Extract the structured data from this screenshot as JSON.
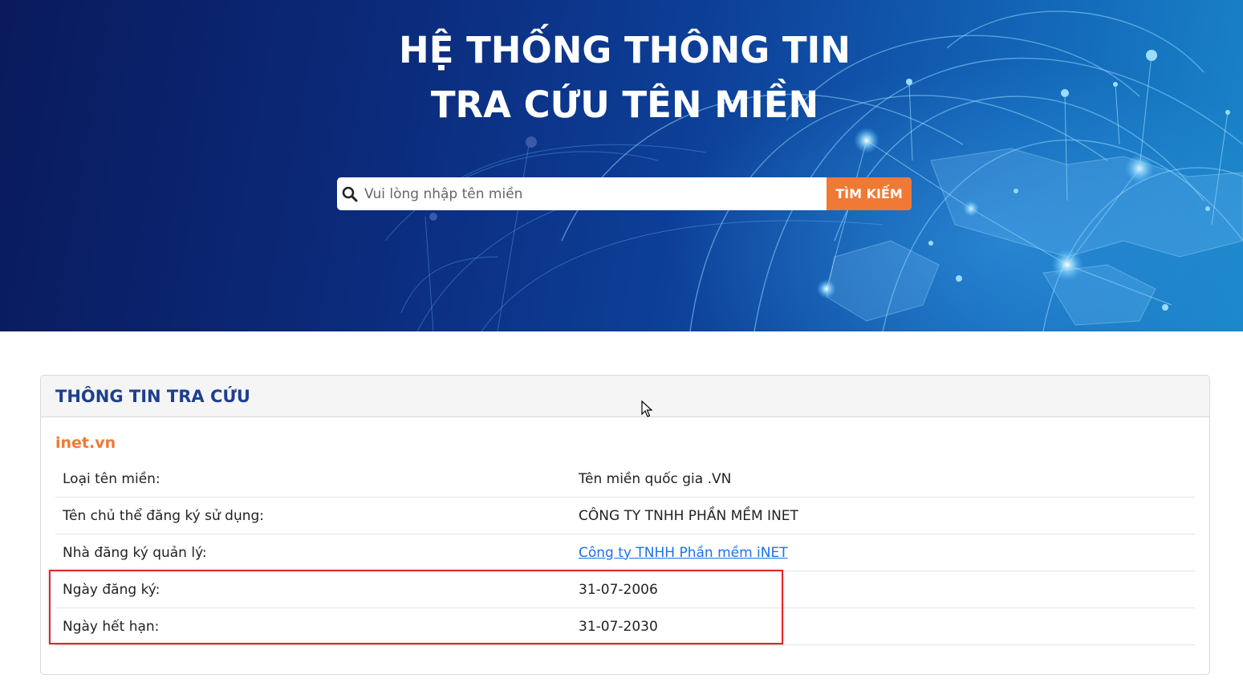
{
  "hero": {
    "title_line1": "HỆ THỐNG THÔNG TIN",
    "title_line2": "TRA CỨU TÊN MIỀN"
  },
  "search": {
    "placeholder": "Vui lòng nhập tên miền",
    "value": "",
    "button_label": "TÌM KIẾM",
    "icon": "search-icon"
  },
  "panel": {
    "title": "THÔNG TIN TRA CỨU",
    "domain": "inet.vn",
    "rows": [
      {
        "label": "Loại tên miền:",
        "value": "Tên miền quốc gia .VN"
      },
      {
        "label": "Tên chủ thể đăng ký sử dụng:",
        "value": "CÔNG TY TNHH PHẦN MỀM INET"
      },
      {
        "label": "Nhà đăng ký quản lý:",
        "value": "Công ty TNHH Phần mềm iNET"
      },
      {
        "label": "Ngày đăng ký:",
        "value": "31-07-2006"
      },
      {
        "label": "Ngày hết hạn:",
        "value": "31-07-2030"
      }
    ]
  },
  "colors": {
    "accent_orange": "#f07935",
    "title_blue": "#1d3f8e",
    "link_blue": "#1a73e8",
    "highlight_red": "#e0262b"
  }
}
